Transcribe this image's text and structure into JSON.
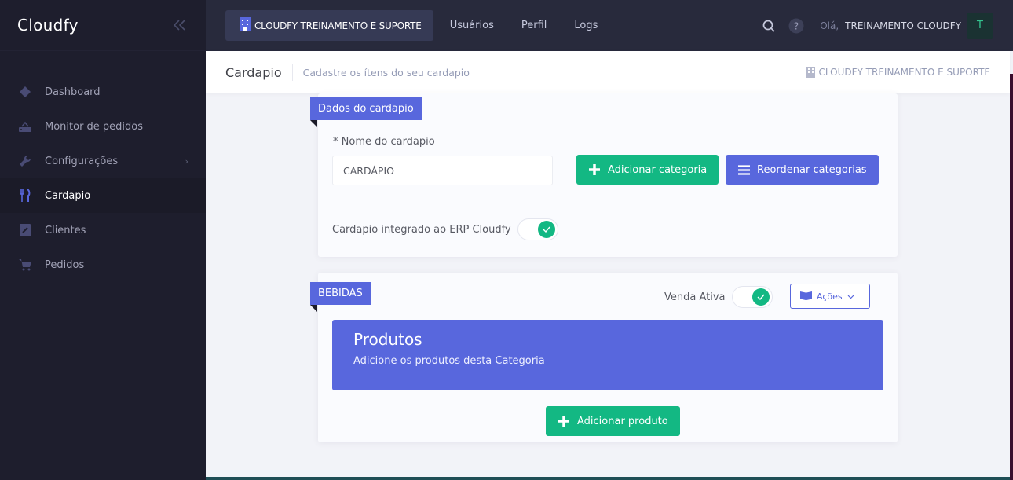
{
  "sidebar": {
    "brand": "Cloudfy",
    "items": [
      {
        "label": "Dashboard",
        "icon": "diamond-icon",
        "active": false,
        "has_arrow": false
      },
      {
        "label": "Monitor de pedidos",
        "icon": "router-icon",
        "active": false,
        "has_arrow": false
      },
      {
        "label": "Configurações",
        "icon": "wrench-icon",
        "active": false,
        "has_arrow": true
      },
      {
        "label": "Cardapio",
        "icon": "fork-knife-icon",
        "active": true,
        "has_arrow": false
      },
      {
        "label": "Clientes",
        "icon": "contact-book-icon",
        "active": false,
        "has_arrow": false
      },
      {
        "label": "Pedidos",
        "icon": "cart-icon",
        "active": false,
        "has_arrow": false
      }
    ]
  },
  "topbar": {
    "org_button": "CLOUDFY TREINAMENTO E SUPORTE",
    "links": [
      "Usuários",
      "Perfil",
      "Logs"
    ],
    "greeting": "Olá,",
    "user_name": "TREINAMENTO CLOUDFY",
    "avatar_initial": "T"
  },
  "subheader": {
    "title": "Cardapio",
    "description": "Cadastre os ítens do seu cardapio",
    "org": "CLOUDFY TREINAMENTO E SUPORTE"
  },
  "card_menu": {
    "ribbon": "Dados do cardapio",
    "name_label_required": "*",
    "name_label": "Nome do cardapio",
    "name_value": "CARDÁPIO",
    "add_category_label": "Adicionar categoria",
    "reorder_categories_label": "Reordenar categorias",
    "erp_toggle_label": "Cardapio integrado ao ERP Cloudfy",
    "erp_toggle_on": true
  },
  "card_category": {
    "ribbon": "BEBIDAS",
    "venda_ativa_label": "Venda Ativa",
    "venda_ativa_on": true,
    "actions_label": "Ações",
    "products_title": "Produtos",
    "products_description": "Adicione os produtos desta Categoria",
    "add_product_label": "Adicionar produto"
  },
  "colors": {
    "primary": "#5867dd",
    "success": "#13b883",
    "sidebar_bg": "#1e1e2d",
    "topbar_bg": "#282a3c"
  }
}
